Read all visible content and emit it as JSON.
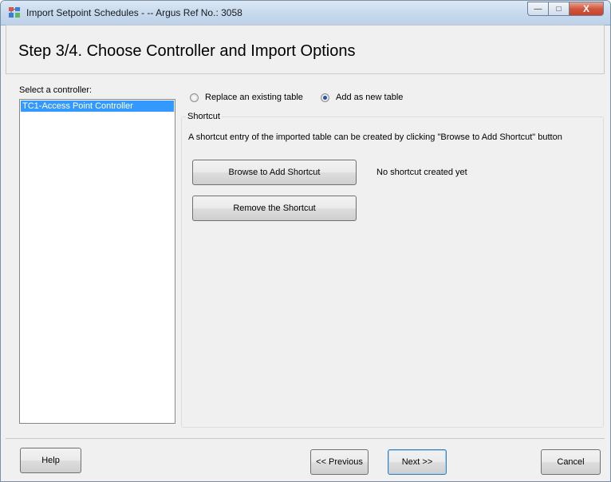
{
  "window": {
    "title": "Import Setpoint Schedules - -- Argus Ref No.: 3058",
    "minimize_glyph": "—",
    "maximize_glyph": "□",
    "close_glyph": "X"
  },
  "header": {
    "title": "Step 3/4. Choose Controller and Import Options"
  },
  "controller_panel": {
    "label": "Select a controller:",
    "items": [
      "TC1-Access Point Controller"
    ],
    "selected_index": 0
  },
  "import_mode": {
    "options": [
      {
        "label": "Replace an existing table",
        "checked": false
      },
      {
        "label": "Add as new table",
        "checked": true
      }
    ]
  },
  "shortcut": {
    "group_label": "Shortcut",
    "description": "A shortcut entry of the imported table can be created by clicking \"Browse to Add Shortcut\" button",
    "browse_label": "Browse to Add Shortcut",
    "remove_label": "Remove the Shortcut",
    "status": "No shortcut created yet"
  },
  "footer": {
    "help_label": "Help",
    "previous_label": "<< Previous",
    "next_label": "Next >>",
    "cancel_label": "Cancel"
  },
  "colors": {
    "selection": "#3399ff",
    "radio_dot": "#2a53a8",
    "close_button": "#c7422a"
  }
}
